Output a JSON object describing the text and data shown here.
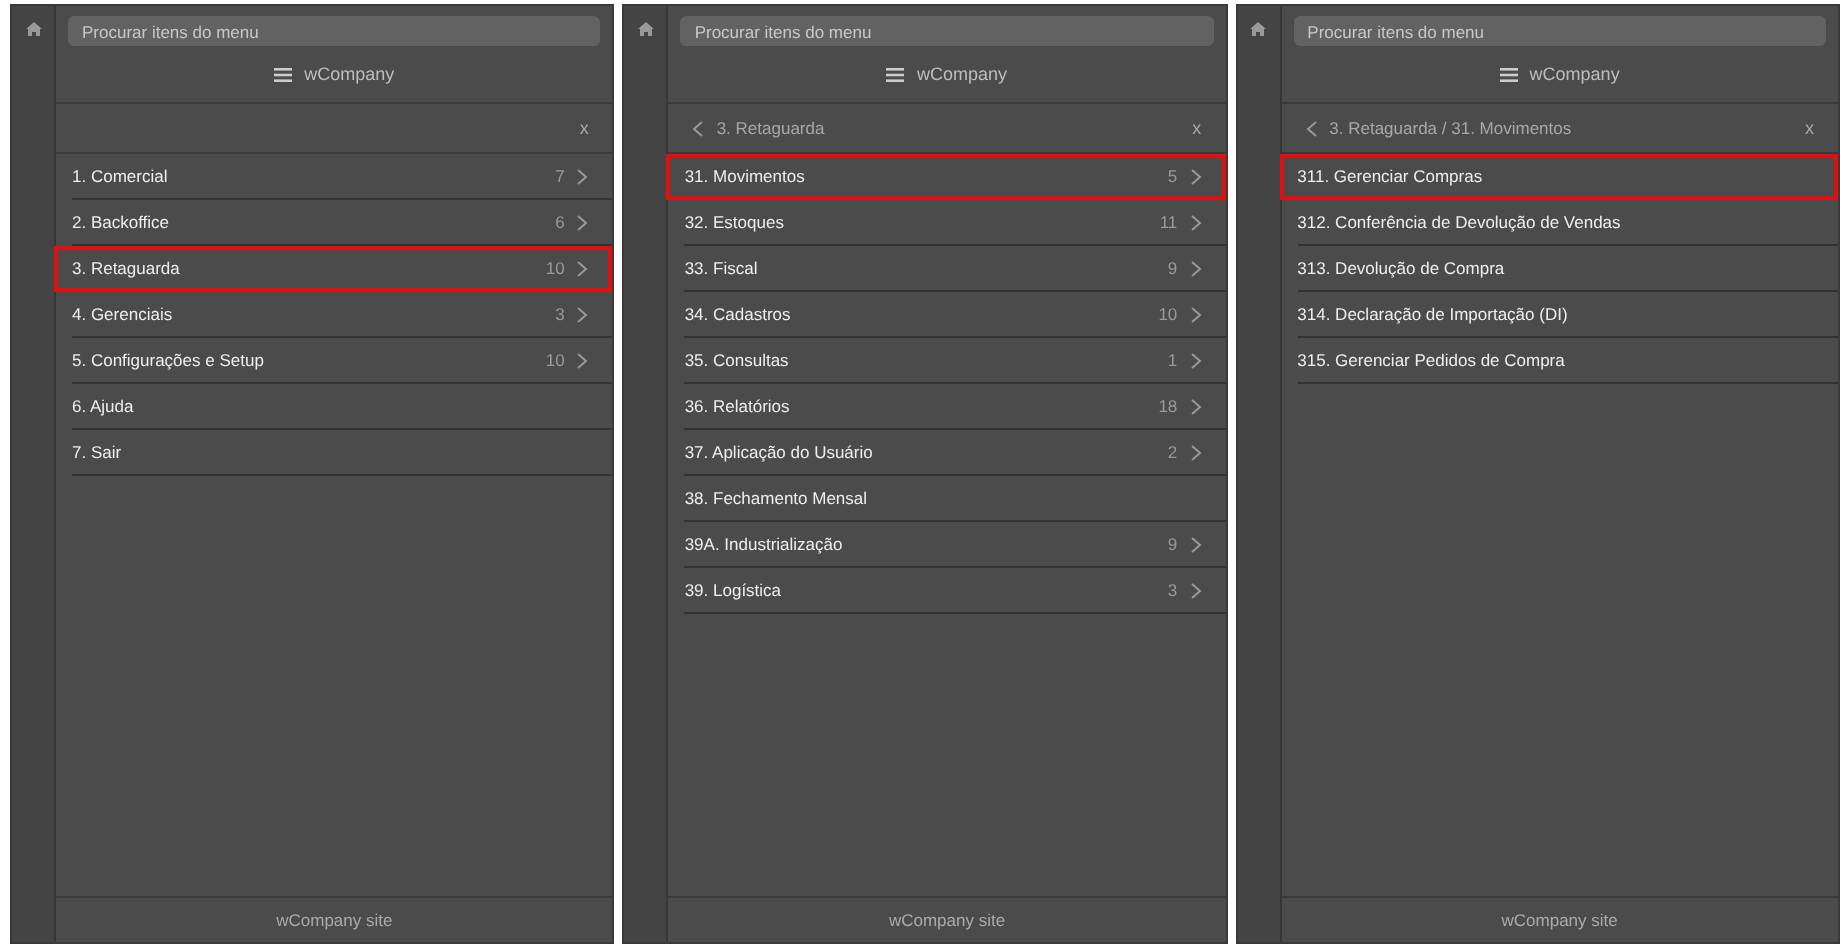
{
  "panels": [
    {
      "search": {
        "placeholder": "Procurar itens do menu"
      },
      "brand": "wCompany",
      "close": "x",
      "footer": "wCompany site",
      "items": [
        {
          "label": "1. Comercial",
          "count": "7",
          "submenu": true,
          "selected": false
        },
        {
          "label": "2. Backoffice",
          "count": "6",
          "submenu": true,
          "selected": false
        },
        {
          "label": "3. Retaguarda",
          "count": "10",
          "submenu": true,
          "selected": true
        },
        {
          "label": "4. Gerenciais",
          "count": "3",
          "submenu": true,
          "selected": false
        },
        {
          "label": "5. Configurações e Setup",
          "count": "10",
          "submenu": true,
          "selected": false
        },
        {
          "label": "6. Ajuda",
          "submenu": false,
          "selected": false
        },
        {
          "label": "7. Sair",
          "submenu": false,
          "selected": false
        }
      ]
    },
    {
      "search": {
        "placeholder": "Procurar itens do menu"
      },
      "brand": "wCompany",
      "breadcrumb": "3. Retaguarda",
      "close": "x",
      "footer": "wCompany site",
      "items": [
        {
          "label": "31. Movimentos",
          "count": "5",
          "submenu": true,
          "selected": true
        },
        {
          "label": "32. Estoques",
          "count": "11",
          "submenu": true,
          "selected": false
        },
        {
          "label": "33. Fiscal",
          "count": "9",
          "submenu": true,
          "selected": false
        },
        {
          "label": "34. Cadastros",
          "count": "10",
          "submenu": true,
          "selected": false
        },
        {
          "label": "35. Consultas",
          "count": "1",
          "submenu": true,
          "selected": false
        },
        {
          "label": "36. Relatórios",
          "count": "18",
          "submenu": true,
          "selected": false
        },
        {
          "label": "37. Aplicação do Usuário",
          "count": "2",
          "submenu": true,
          "selected": false
        },
        {
          "label": "38. Fechamento Mensal",
          "submenu": false,
          "selected": false
        },
        {
          "label": "39A. Industrialização",
          "count": "9",
          "submenu": true,
          "selected": false
        },
        {
          "label": "39. Logística",
          "count": "3",
          "submenu": true,
          "selected": false
        }
      ]
    },
    {
      "search": {
        "placeholder": "Procurar itens do menu"
      },
      "brand": "wCompany",
      "breadcrumb": "3. Retaguarda / 31. Movimentos",
      "close": "x",
      "footer": "wCompany site",
      "items": [
        {
          "label": "311. Gerenciar Compras",
          "submenu": false,
          "selected": true
        },
        {
          "label": "312. Conferência de Devolução de Vendas",
          "submenu": false,
          "selected": false
        },
        {
          "label": "313. Devolução de Compra",
          "submenu": false,
          "selected": false
        },
        {
          "label": "314. Declaração de Importação (DI)",
          "submenu": false,
          "selected": false
        },
        {
          "label": "315. Gerenciar Pedidos de Compra",
          "submenu": false,
          "selected": false
        }
      ]
    }
  ]
}
